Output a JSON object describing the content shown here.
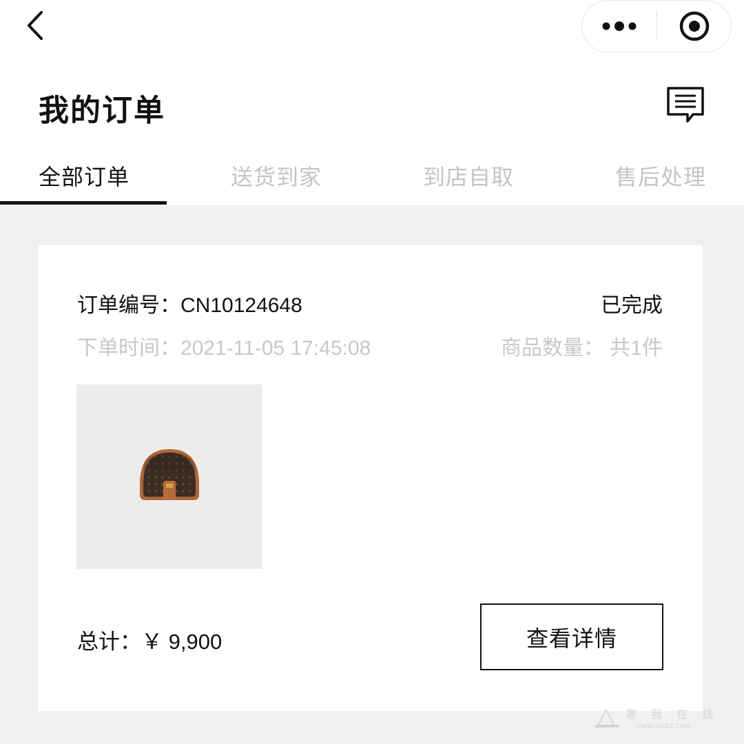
{
  "header": {
    "title": "我的订单",
    "back_icon": "chevron-left-icon",
    "more_icon": "more-dots-icon",
    "close_icon": "target-circle-icon",
    "message_icon": "message-icon"
  },
  "tabs": [
    {
      "label": "全部订单",
      "active": true
    },
    {
      "label": "送货到家",
      "active": false
    },
    {
      "label": "到店自取",
      "active": false
    },
    {
      "label": "售后处理",
      "active": false
    }
  ],
  "order": {
    "number_text": "订单编号：CN10124648",
    "status": "已完成",
    "time_text": "下单时间：2021-11-05 17:45:08",
    "quantity_text": "商品数量： 共1件",
    "total_text": "总计：￥ 9,900",
    "detail_button": "查看详情"
  },
  "watermark": {
    "text": "奢 我 在 线",
    "subtext": "WWW.SWZX.COM"
  },
  "colors": {
    "background": "#f0f0f0",
    "text_primary": "#111111",
    "text_muted": "#c4c4c4",
    "card": "#ffffff"
  }
}
